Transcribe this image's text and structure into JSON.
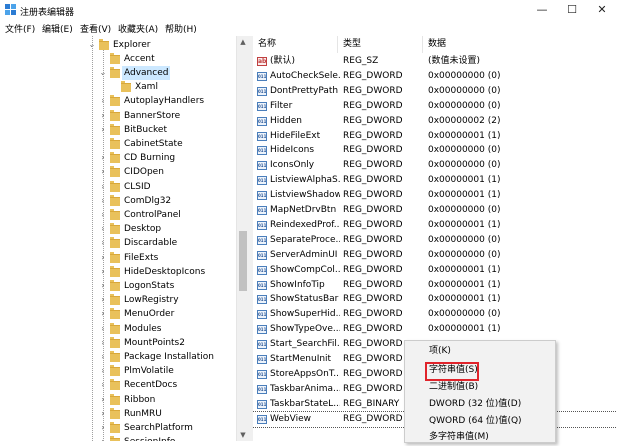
{
  "window": {
    "title": "注册表编辑器",
    "minimize_glyph": "—",
    "maximize_glyph": "☐",
    "close_glyph": "✕"
  },
  "menu": [
    "文件(F)",
    "编辑(E)",
    "查看(V)",
    "收藏夹(A)",
    "帮助(H)"
  ],
  "tree": {
    "items": [
      {
        "label": "Explorer",
        "expander": "⌄",
        "selected": false
      },
      {
        "label": "Accent",
        "expander": "",
        "selected": false
      },
      {
        "label": "Advanced",
        "expander": "⌄",
        "selected": true
      },
      {
        "label": "Xaml",
        "expander": "",
        "selected": false
      },
      {
        "label": "AutoplayHandlers",
        "expander": "›",
        "selected": false
      },
      {
        "label": "BannerStore",
        "expander": "›",
        "selected": false
      },
      {
        "label": "BitBucket",
        "expander": "›",
        "selected": false
      },
      {
        "label": "CabinetState",
        "expander": "",
        "selected": false
      },
      {
        "label": "CD Burning",
        "expander": "›",
        "selected": false
      },
      {
        "label": "CIDOpen",
        "expander": "›",
        "selected": false
      },
      {
        "label": "CLSID",
        "expander": "›",
        "selected": false
      },
      {
        "label": "ComDlg32",
        "expander": "›",
        "selected": false
      },
      {
        "label": "ControlPanel",
        "expander": "›",
        "selected": false
      },
      {
        "label": "Desktop",
        "expander": "›",
        "selected": false
      },
      {
        "label": "Discardable",
        "expander": "›",
        "selected": false
      },
      {
        "label": "FileExts",
        "expander": "›",
        "selected": false
      },
      {
        "label": "HideDesktopIcons",
        "expander": "›",
        "selected": false
      },
      {
        "label": "LogonStats",
        "expander": "›",
        "selected": false
      },
      {
        "label": "LowRegistry",
        "expander": "›",
        "selected": false
      },
      {
        "label": "MenuOrder",
        "expander": "›",
        "selected": false
      },
      {
        "label": "Modules",
        "expander": "›",
        "selected": false
      },
      {
        "label": "MountPoints2",
        "expander": "›",
        "selected": false
      },
      {
        "label": "Package Installation",
        "expander": "›",
        "selected": false
      },
      {
        "label": "PlmVolatile",
        "expander": "›",
        "selected": false
      },
      {
        "label": "RecentDocs",
        "expander": "›",
        "selected": false
      },
      {
        "label": "Ribbon",
        "expander": "›",
        "selected": false
      },
      {
        "label": "RunMRU",
        "expander": "›",
        "selected": false
      },
      {
        "label": "SearchPlatform",
        "expander": "›",
        "selected": false
      },
      {
        "label": "SessionInfo",
        "expander": "›",
        "selected": false
      }
    ]
  },
  "scrollbar": {
    "up": "▲",
    "down": "▼"
  },
  "list": {
    "headers": {
      "name": "名称",
      "type": "类型",
      "data": "数据"
    },
    "rows": [
      {
        "name": "(默认)",
        "type": "REG_SZ",
        "data": "(数值未设置)",
        "icon": "ab"
      },
      {
        "name": "AutoCheckSele...",
        "type": "REG_DWORD",
        "data": "0x00000000 (0)",
        "icon": "011"
      },
      {
        "name": "DontPrettyPath",
        "type": "REG_DWORD",
        "data": "0x00000000 (0)",
        "icon": "011"
      },
      {
        "name": "Filter",
        "type": "REG_DWORD",
        "data": "0x00000000 (0)",
        "icon": "011"
      },
      {
        "name": "Hidden",
        "type": "REG_DWORD",
        "data": "0x00000002 (2)",
        "icon": "011"
      },
      {
        "name": "HideFileExt",
        "type": "REG_DWORD",
        "data": "0x00000001 (1)",
        "icon": "011"
      },
      {
        "name": "HideIcons",
        "type": "REG_DWORD",
        "data": "0x00000000 (0)",
        "icon": "011"
      },
      {
        "name": "IconsOnly",
        "type": "REG_DWORD",
        "data": "0x00000000 (0)",
        "icon": "011"
      },
      {
        "name": "ListviewAlphaS...",
        "type": "REG_DWORD",
        "data": "0x00000001 (1)",
        "icon": "011"
      },
      {
        "name": "ListviewShadow",
        "type": "REG_DWORD",
        "data": "0x00000001 (1)",
        "icon": "011"
      },
      {
        "name": "MapNetDrvBtn",
        "type": "REG_DWORD",
        "data": "0x00000000 (0)",
        "icon": "011"
      },
      {
        "name": "ReindexedProf...",
        "type": "REG_DWORD",
        "data": "0x00000001 (1)",
        "icon": "011"
      },
      {
        "name": "SeparateProce...",
        "type": "REG_DWORD",
        "data": "0x00000000 (0)",
        "icon": "011"
      },
      {
        "name": "ServerAdminUI",
        "type": "REG_DWORD",
        "data": "0x00000000 (0)",
        "icon": "011"
      },
      {
        "name": "ShowCompCol...",
        "type": "REG_DWORD",
        "data": "0x00000001 (1)",
        "icon": "011"
      },
      {
        "name": "ShowInfoTip",
        "type": "REG_DWORD",
        "data": "0x00000001 (1)",
        "icon": "011"
      },
      {
        "name": "ShowStatusBar",
        "type": "REG_DWORD",
        "data": "0x00000001 (1)",
        "icon": "011"
      },
      {
        "name": "ShowSuperHid...",
        "type": "REG_DWORD",
        "data": "0x00000000 (0)",
        "icon": "011"
      },
      {
        "name": "ShowTypeOve...",
        "type": "REG_DWORD",
        "data": "0x00000001 (1)",
        "icon": "011"
      },
      {
        "name": "Start_SearchFil...",
        "type": "REG_DWORD",
        "data": "",
        "icon": "011"
      },
      {
        "name": "StartMenuInit",
        "type": "REG_DWORD",
        "data": "",
        "icon": "011"
      },
      {
        "name": "StoreAppsOnT...",
        "type": "REG_DWORD",
        "data": "",
        "icon": "011"
      },
      {
        "name": "TaskbarAnima...",
        "type": "REG_DWORD",
        "data": "",
        "icon": "011"
      },
      {
        "name": "TaskbarStateL...",
        "type": "REG_BINARY",
        "data": "",
        "icon": "011"
      },
      {
        "name": "WebView",
        "type": "REG_DWORD",
        "data": "",
        "icon": "011"
      }
    ]
  },
  "context_menu": {
    "items": [
      {
        "label": "项(K)",
        "highlighted": false
      },
      {
        "label": "字符串值(S)",
        "highlighted": true
      },
      {
        "label": "二进制值(B)",
        "highlighted": false
      },
      {
        "label": "DWORD (32 位)值(D)",
        "highlighted": false
      },
      {
        "label": "QWORD (64 位)值(Q)",
        "highlighted": false
      },
      {
        "label": "多字符串值(M)",
        "highlighted": false
      }
    ],
    "highlight_color": "#e0242b"
  }
}
